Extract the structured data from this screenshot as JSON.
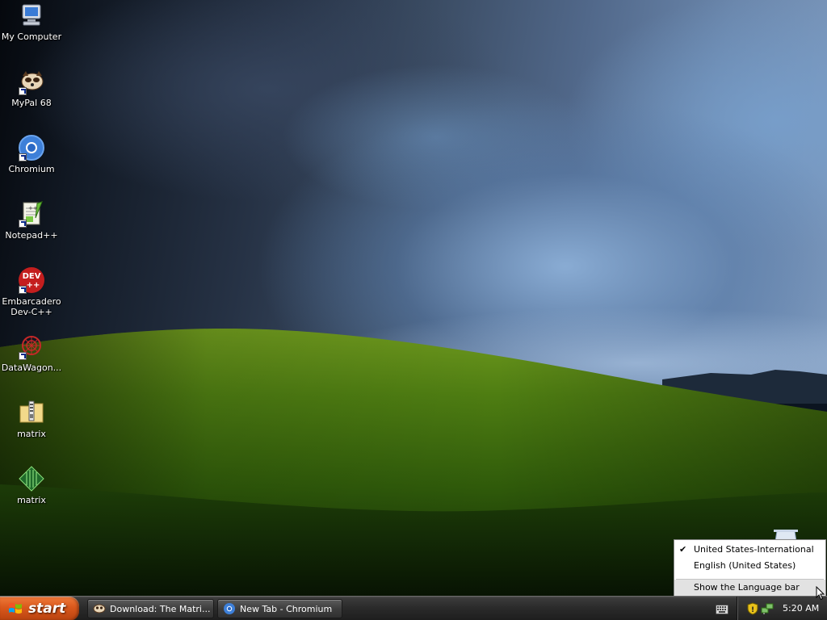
{
  "desktop": {
    "icons": [
      {
        "label": "My Computer",
        "icon": "my-computer-icon",
        "shortcut": false
      },
      {
        "label": "MyPal 68",
        "icon": "mypal-icon",
        "shortcut": true
      },
      {
        "label": "Chromium",
        "icon": "chromium-icon",
        "shortcut": true
      },
      {
        "label": "Notepad++",
        "icon": "notepad-plus-plus-icon",
        "shortcut": true
      },
      {
        "label": "Embarcadero\nDev-C++",
        "icon": "dev-cpp-icon",
        "shortcut": true
      },
      {
        "label": "DataWagon...",
        "icon": "datawagon-icon",
        "shortcut": true
      },
      {
        "label": "matrix",
        "icon": "zip-folder-icon",
        "shortcut": false
      },
      {
        "label": "matrix",
        "icon": "matrix-app-icon",
        "shortcut": false
      }
    ]
  },
  "taskbar": {
    "start_label": "start",
    "tasks": [
      {
        "label": "Download: The Matri...",
        "icon": "mypal-icon"
      },
      {
        "label": "New Tab - Chromium",
        "icon": "chromium-icon"
      }
    ],
    "clock": "5:20 AM"
  },
  "lang_menu": {
    "items": [
      {
        "label": "United States-International",
        "checked": true
      },
      {
        "label": "English (United States)",
        "checked": false
      }
    ],
    "show_bar_label": "Show the Language bar",
    "check_glyph": "✔"
  },
  "colors": {
    "start_orange": "#d9581c",
    "taskbar_dark": "#2a2a2a",
    "menu_highlight": "#e2e2e2"
  }
}
